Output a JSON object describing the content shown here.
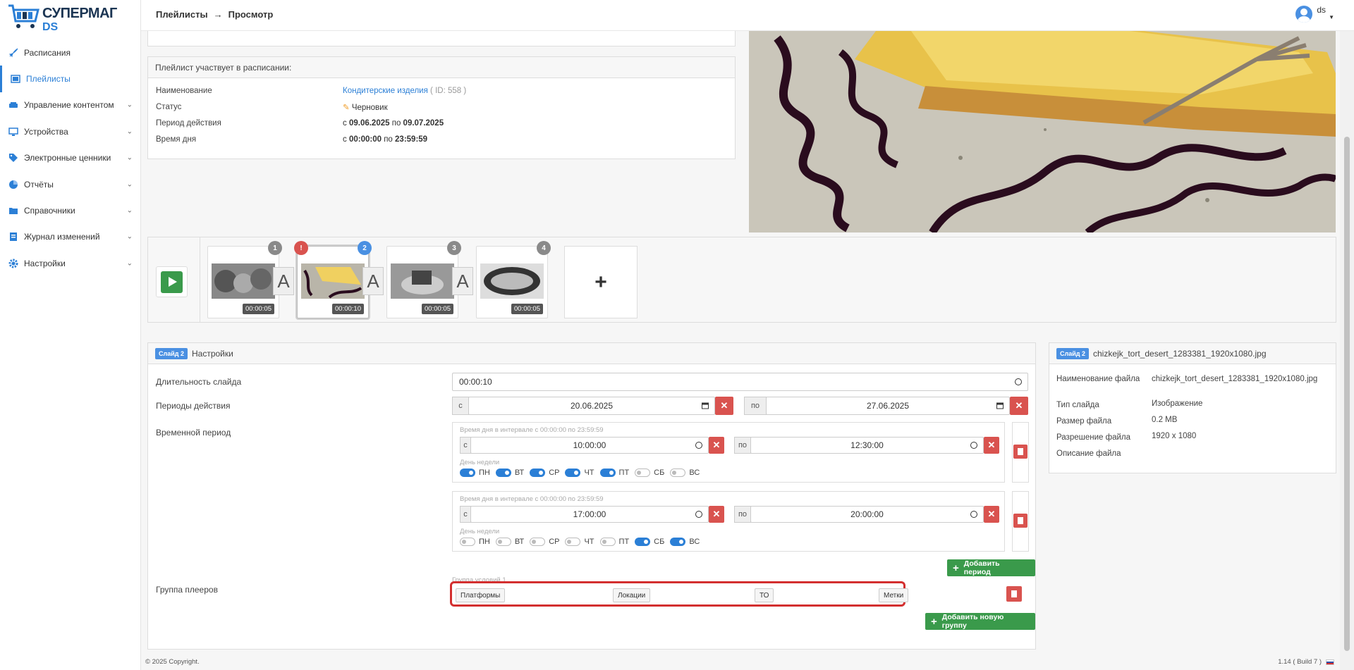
{
  "app": {
    "logo_line1": "СУПЕРМАГ",
    "logo_line2": "DS"
  },
  "sidebar": {
    "items": [
      {
        "label": "Расписания",
        "icon": "rocket-icon",
        "chevron": false
      },
      {
        "label": "Плейлисты",
        "icon": "playlist-icon",
        "chevron": false,
        "active": true
      },
      {
        "label": "Управление контентом",
        "icon": "content-icon",
        "chevron": true
      },
      {
        "label": "Устройства",
        "icon": "monitor-icon",
        "chevron": true
      },
      {
        "label": "Электронные ценники",
        "icon": "tag-icon",
        "chevron": true
      },
      {
        "label": "Отчёты",
        "icon": "pie-chart-icon",
        "chevron": true
      },
      {
        "label": "Справочники",
        "icon": "folder-icon",
        "chevron": true
      },
      {
        "label": "Журнал изменений",
        "icon": "journal-icon",
        "chevron": true
      },
      {
        "label": "Настройки",
        "icon": "gear-icon",
        "chevron": true
      }
    ]
  },
  "header": {
    "crumb1": "Плейлисты",
    "crumb2": "Просмотр",
    "user": "ds"
  },
  "schedule": {
    "title": "Плейлист участвует в расписании:",
    "name_label": "Наименование",
    "name_value": "Кондитерские изделия",
    "name_id": "( ID: 558 )",
    "status_label": "Статус",
    "status_value": "Черновик",
    "period_label": "Период действия",
    "period_from_pre": "с",
    "period_from": "09.06.2025",
    "period_to_pre": "по",
    "period_to": "09.07.2025",
    "time_label": "Время дня",
    "time_from_pre": "с",
    "time_from": "00:00:00",
    "time_to_pre": "по",
    "time_to": "23:59:59"
  },
  "slides": [
    {
      "num": "1",
      "duration": "00:00:05"
    },
    {
      "num": "2",
      "duration": "00:00:10"
    },
    {
      "num": "3",
      "duration": "00:00:05"
    },
    {
      "num": "4",
      "duration": "00:00:05"
    }
  ],
  "transition_letter": "A",
  "add_slide": "+",
  "settings": {
    "tag": "Слайд 2",
    "title": "Настройки",
    "duration_label": "Длительность слайда",
    "duration_value": "00:00:10",
    "periods_label": "Периоды действия",
    "from_addon": "с",
    "date_from": "20.06.2025",
    "to_addon": "по",
    "date_to": "27.06.2025",
    "time_period_label": "Временной период",
    "time_periods": [
      {
        "hint": "Время дня в интервале с 00:00:00 по 23:59:59",
        "from_addon": "с",
        "from": "10:00:00",
        "to_addon": "по",
        "to": "12:30:00",
        "days_hint": "День недели",
        "days": [
          true,
          true,
          true,
          true,
          true,
          false,
          false
        ]
      },
      {
        "hint": "Время дня в интервале с 00:00:00 по 23:59:59",
        "from_addon": "с",
        "from": "17:00:00",
        "to_addon": "по",
        "to": "20:00:00",
        "days_hint": "День недели",
        "days": [
          false,
          false,
          false,
          false,
          false,
          true,
          true
        ]
      }
    ],
    "day_names": [
      "ПН",
      "ВТ",
      "СР",
      "ЧТ",
      "ПТ",
      "СБ",
      "ВС"
    ],
    "add_period": "Добавить период",
    "player_group_label": "Группа плееров",
    "group_hint": "Группа условий 1",
    "chips": [
      "Платформы",
      "Локации",
      "ТО",
      "Метки"
    ],
    "add_group": "Добавить новую группу"
  },
  "file_info": {
    "tag": "Слайд 2",
    "title": "chizkejk_tort_desert_1283381_1920x1080.jpg",
    "rows": [
      {
        "k": "Наименование файла",
        "v": "chizkejk_tort_desert_1283381_1920x1080.jpg"
      },
      {
        "k": "Тип слайда",
        "v": "Изображение"
      },
      {
        "k": "Размер файла",
        "v": "0.2 MB"
      },
      {
        "k": "Разрешение файла",
        "v": "1920 x 1080"
      },
      {
        "k": "Описание файла",
        "v": ""
      }
    ]
  },
  "footer": {
    "copyright": "© 2025 Copyright.",
    "version": "1.14 ( Build 7 )"
  },
  "colors": {
    "accent": "#2b7fd6",
    "danger": "#d9534f",
    "success": "#3a9a4b"
  }
}
